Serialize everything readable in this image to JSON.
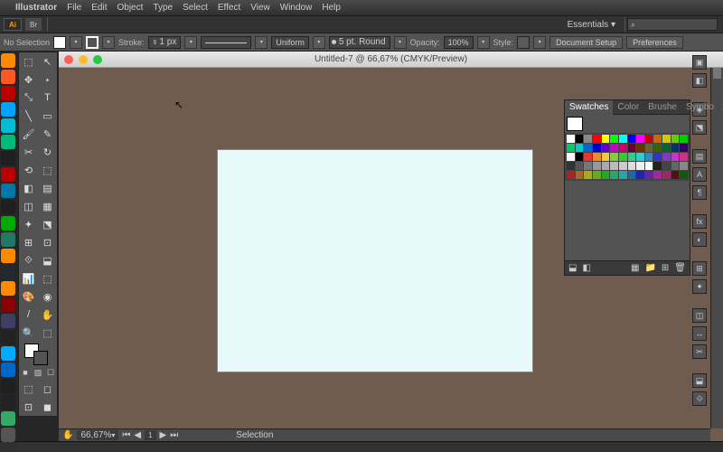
{
  "menubar": {
    "app": "Illustrator",
    "items": [
      "File",
      "Edit",
      "Object",
      "Type",
      "Select",
      "Effect",
      "View",
      "Window",
      "Help"
    ]
  },
  "topbar": {
    "ai": "Ai",
    "br": "Br",
    "workspace": "Essentials"
  },
  "ctrlbar": {
    "selection": "No Selection",
    "stroke_lbl": "Stroke:",
    "stroke_val": "1 px",
    "uniform": "Uniform",
    "pt": "5 pt. Round",
    "opacity_lbl": "Opacity:",
    "opacity_val": "100%",
    "style_lbl": "Style:",
    "docsetup": "Document Setup",
    "prefs": "Preferences"
  },
  "doc": {
    "title": "Untitled-7 @ 66,67% (CMYK/Preview)",
    "zoom": "66,67%",
    "artboard": "1",
    "mode": "Selection"
  },
  "swatches": {
    "tabs": [
      "Swatches",
      "Color",
      "Brushe",
      "Symbo"
    ]
  },
  "dock_colors": [
    "#ff8a00",
    "#ff5722",
    "#b00",
    "#00a2ff",
    "#00bcd4",
    "#0b7",
    "#1f1f1f",
    "#b00",
    "#07a",
    "#1f1f1f",
    "#0a0",
    "#276",
    "#ff8a00",
    "#22282f",
    "#ff8a00",
    "#8b0000",
    "#3f3f66",
    "#222",
    "#0af",
    "#06c",
    "#1f1f1f",
    "#222",
    "#3a6",
    "#555"
  ],
  "swatch_colors": [
    "#fff",
    "#000",
    "#888",
    "#f00",
    "#ff0",
    "#0f0",
    "#0ff",
    "#00f",
    "#f0f",
    "#c00",
    "#c60",
    "#cc0",
    "#6c0",
    "#0c0",
    "#0c6",
    "#0cc",
    "#06c",
    "#00c",
    "#60c",
    "#c0c",
    "#c06",
    "#603",
    "#630",
    "#663",
    "#360",
    "#063",
    "#036",
    "#306",
    "#fff",
    "#000",
    "#e33",
    "#e83",
    "#ec3",
    "#8c3",
    "#3c3",
    "#3c8",
    "#3cc",
    "#38c",
    "#33c",
    "#83c",
    "#c3c",
    "#c38",
    "#333",
    "#555",
    "#777",
    "#999",
    "#aaa",
    "#bbb",
    "#ccc",
    "#ddd",
    "#eee",
    "#fff",
    "#222",
    "#444",
    "#666",
    "#888",
    "#a22",
    "#a62",
    "#aa2",
    "#6a2",
    "#2a2",
    "#2a6",
    "#2aa",
    "#26a",
    "#22a",
    "#62a",
    "#a2a",
    "#a26",
    "#511",
    "#151"
  ]
}
